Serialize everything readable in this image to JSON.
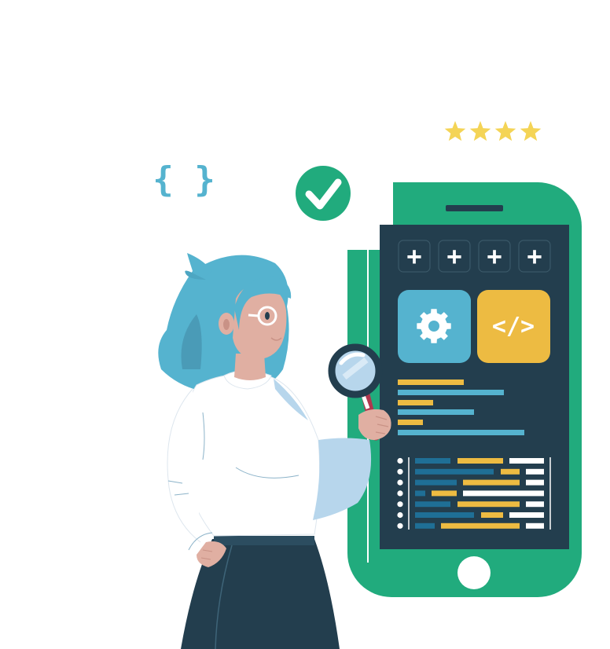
{
  "rating": {
    "stars": 4,
    "max": 4
  },
  "braces_label": "{ }",
  "code_tile_label": "</>",
  "plus_buttons": [
    "+",
    "+",
    "+",
    "+"
  ],
  "colors": {
    "phone": "#21AB7D",
    "screen": "#233E4E",
    "hair": "#55B3CF",
    "check": "#21AB7D",
    "star": "#F4D456",
    "blue_tile": "#55B3CF",
    "yellow_tile": "#EDBB42",
    "skin": "#E0AFA2",
    "shirt": "#FFFFFF",
    "sleeve": "#B7D6EC",
    "skirt": "#233E4E"
  },
  "icons": {
    "status": "checkmark-icon",
    "settings": "gear-icon",
    "tool": "magnifier-icon"
  }
}
